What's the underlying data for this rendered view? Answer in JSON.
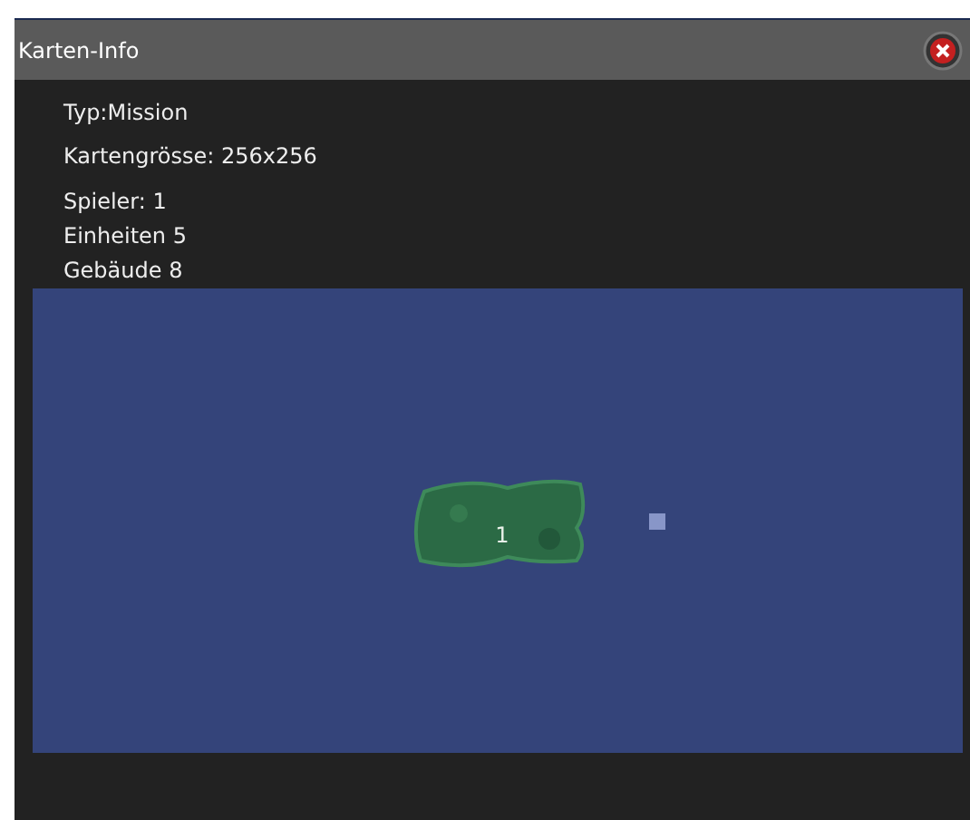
{
  "window": {
    "title": "Karten-Info"
  },
  "info": [
    "Typ:Mission",
    "Kartengrösse: 256x256"
  ],
  "stats": [
    "Spieler: 1",
    "Einheiten 5",
    "Gebäude 8"
  ],
  "map": {
    "start_label": "1"
  }
}
